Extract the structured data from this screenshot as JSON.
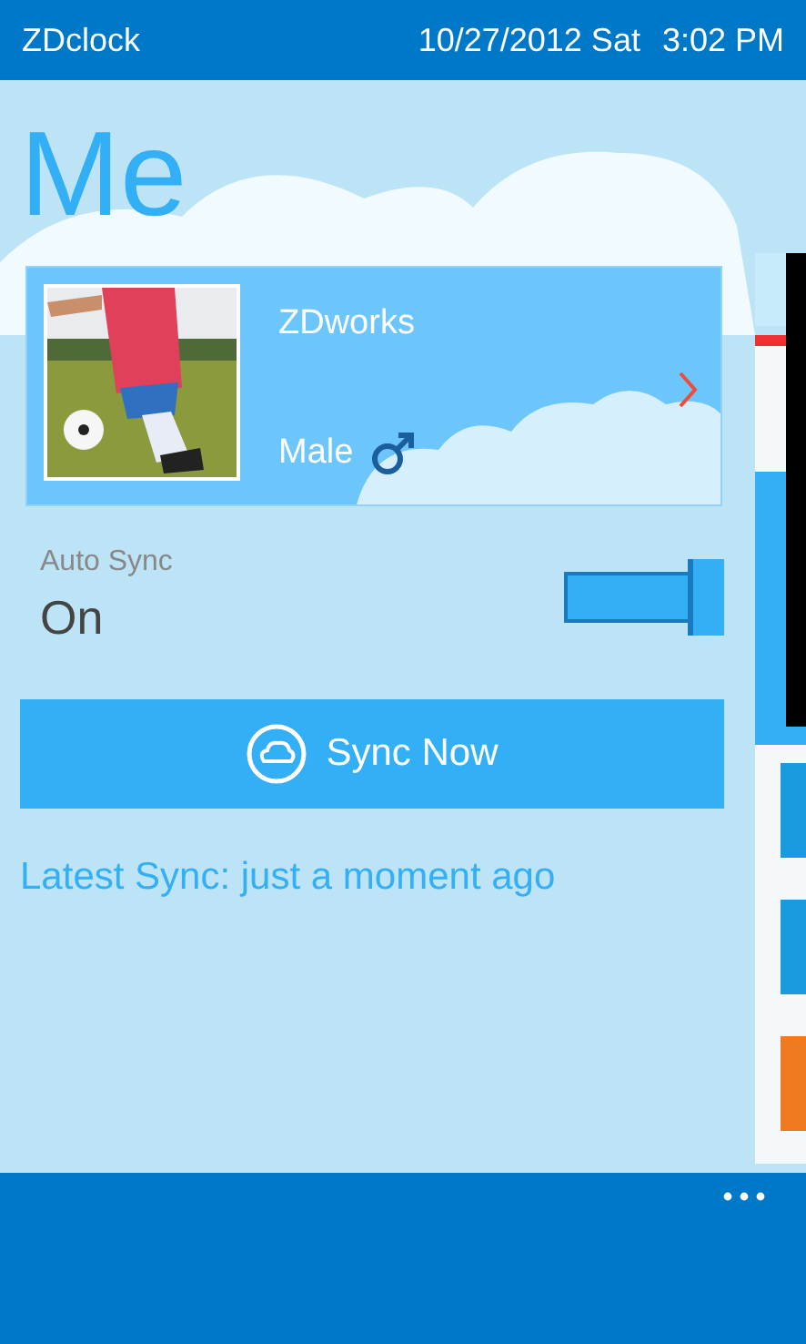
{
  "status_bar": {
    "app": "ZDclock",
    "date": "10/27/2012 Sat",
    "time": "3:02 PM"
  },
  "page_title": "Me",
  "profile": {
    "name": "ZDworks",
    "gender": "Male"
  },
  "auto_sync": {
    "label": "Auto Sync",
    "value": "On",
    "on": true
  },
  "sync_button": "Sync Now",
  "latest_sync": "Latest Sync: just a moment ago"
}
